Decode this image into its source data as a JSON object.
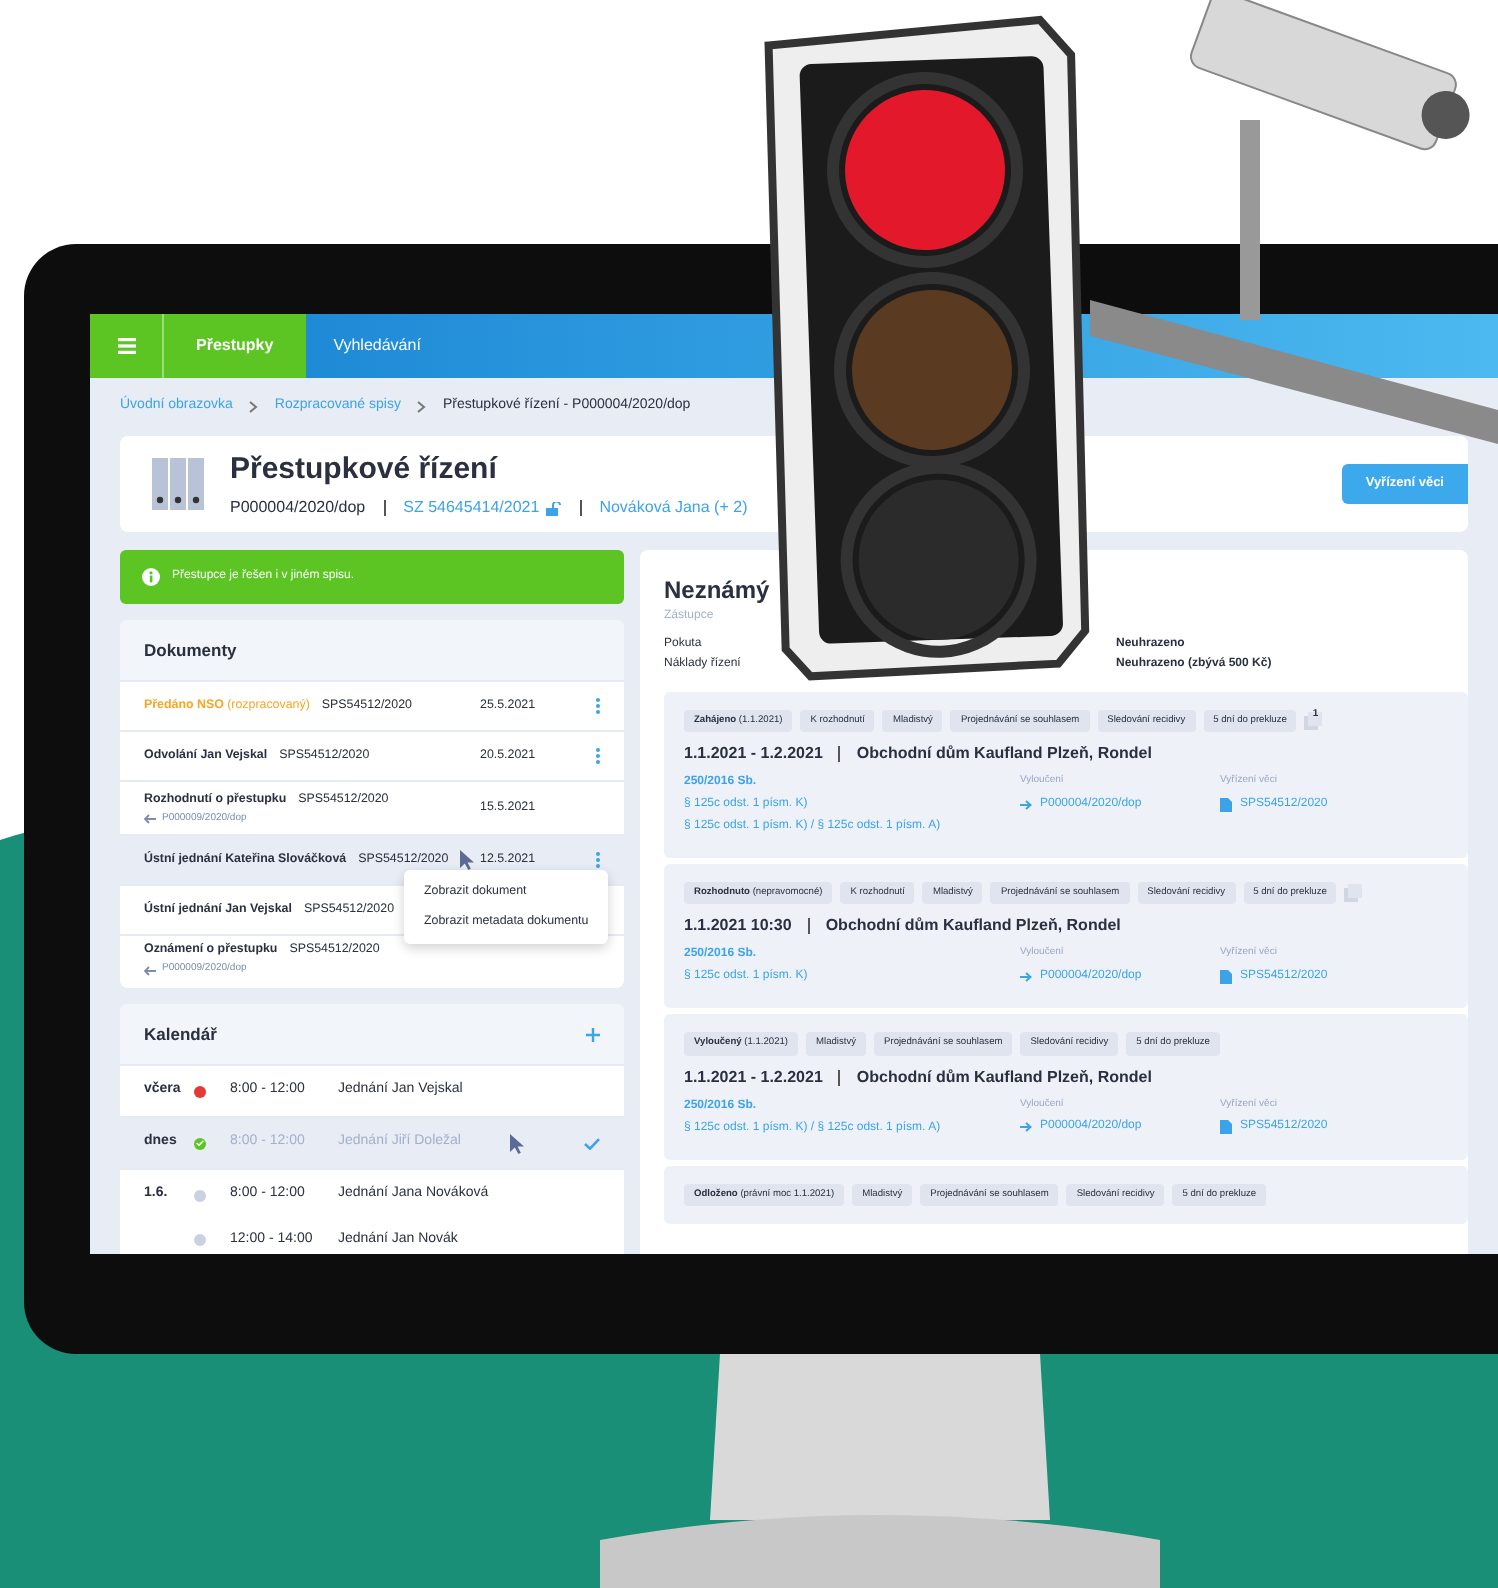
{
  "navbar": {
    "tabs": [
      {
        "label": "Přestupky",
        "selected": true
      },
      {
        "label": "Vyhledávání",
        "selected": false
      }
    ]
  },
  "breadcrumb": [
    "Úvodní obrazovka",
    "Rozpracované spisy",
    "Přestupkové řízení - P000004/2020/dop"
  ],
  "header": {
    "title": "Přestupkové řízení",
    "number": "P000004/2020/dop",
    "link": "SZ 54645414/2021",
    "persons": "Nováková Jana (+ 2)",
    "button": "Vyřízení věci"
  },
  "alert": {
    "text": "Přestupce je řešen i v jiném spisu."
  },
  "documents": {
    "title": "Dokumenty",
    "rows": [
      {
        "kind": "draft",
        "name": "Předáno NSO",
        "status": "(rozpracovaný)",
        "code": "SPS54512/2020",
        "date": "25.5.2021",
        "actions": true,
        "selected": false
      },
      {
        "kind": "normal",
        "name": "Odvolání Jan Vejskal",
        "code": "SPS54512/2020",
        "date": "20.5.2021",
        "actions": true,
        "selected": false
      },
      {
        "kind": "normal",
        "name": "Rozhodnutí o přestupku",
        "code": "SPS54512/2020",
        "date": "15.5.2021",
        "ref": "P000009/2020/dop",
        "actions": false,
        "selected": false
      },
      {
        "kind": "normal",
        "name": "Ústní jednání Kateřina Slováčková",
        "code": "SPS54512/2020",
        "date": "12.5.2021",
        "actions": true,
        "selected": true
      },
      {
        "kind": "normal",
        "name": "Ústní jednání Jan Vejskal",
        "code": "SPS54512/2020",
        "actions": false,
        "selected": false
      },
      {
        "kind": "normal",
        "name": "Oznámení o přestupku",
        "code": "SPS54512/2020",
        "ref": "P000009/2020/dop",
        "actions": false,
        "selected": false
      }
    ],
    "menu": [
      "Zobrazit dokument",
      "Zobrazit metadata dokumentu"
    ]
  },
  "calendar": {
    "title": "Kalendář",
    "events": [
      {
        "day": "včera",
        "color": "#e53935",
        "time": "8:00 - 12:00",
        "title": "Jednání Jan Vejskal",
        "done": false,
        "selected": false
      },
      {
        "day": "dnes",
        "color": "#5cc524",
        "time": "8:00 - 12:00",
        "title": "Jednání Jiří Doležal",
        "done": true,
        "selected": true
      },
      {
        "day": "1.6.",
        "color": "#c9d2e3",
        "time": "8:00 - 12:00",
        "title": "Jednání Jana Nováková",
        "done": false,
        "selected": false
      },
      {
        "color": "#c9d2e3",
        "time": "12:00 - 14:00",
        "title": "Jednání Jan Novák",
        "done": false,
        "selected": false
      }
    ]
  },
  "party": {
    "name": "Neznámý",
    "role": "Zástupce",
    "payments": [
      {
        "label": "Pokuta",
        "value": "Neuhrazeno"
      },
      {
        "label": "Náklady řízení",
        "value": "Neuhrazeno (zbývá 500 Kč)"
      }
    ]
  },
  "cases": [
    {
      "status": {
        "label": "Zahájeno",
        "note": "(1.1.2021)"
      },
      "tags": [
        "K rozhodnutí",
        "Mladistvý",
        "Projednávání se souhlasem",
        "Sledování recidivy",
        "5 dní do prekluze"
      ],
      "copy_icon": true,
      "copy_count": "1",
      "date": "1.1.2021 - 1.2.2021",
      "place": "Obchodní dům Kaufland Plzeň, Rondel",
      "law": "250/2016 Sb.",
      "paragraphs": [
        "§ 125c odst. 1 písm. K)",
        "§ 125c odst. 1 písm. K) / § 125c odst. 1 písm. A)"
      ],
      "exclusion_label": "Vyloučení",
      "exclusion": "P000004/2020/dop",
      "resolution_label": "Vyřízení věci",
      "resolution": "SPS54512/2020"
    },
    {
      "status": {
        "label": "Rozhodnuto",
        "note": "(nepravomocné)"
      },
      "tags": [
        "K rozhodnutí",
        "Mladistvý",
        "Projednávání se souhlasem",
        "Sledování recidivy",
        "5 dní do prekluze"
      ],
      "copy_icon": true,
      "date": "1.1.2021 10:30",
      "place": "Obchodní dům Kaufland Plzeň, Rondel",
      "law": "250/2016 Sb.",
      "paragraphs": [
        "§ 125c odst. 1 písm. K)"
      ],
      "exclusion_label": "Vyloučení",
      "exclusion": "P000004/2020/dop",
      "resolution_label": "Vyřízení věci",
      "resolution": "SPS54512/2020"
    },
    {
      "status": {
        "label": "Vyloučený",
        "note": "(1.1.2021)"
      },
      "tags": [
        "Mladistvý",
        "Projednávání se souhlasem",
        "Sledování recidivy",
        "5 dní do prekluze"
      ],
      "copy_icon": false,
      "date": "1.1.2021 - 1.2.2021",
      "place": "Obchodní dům Kaufland Plzeň, Rondel",
      "law": "250/2016 Sb.",
      "paragraphs": [
        "§ 125c odst. 1 písm. K) / § 125c odst. 1 písm. A)"
      ],
      "exclusion_label": "Vyloučení",
      "exclusion": "P000004/2020/dop",
      "resolution_label": "Vyřízení věci",
      "resolution": "SPS54512/2020"
    },
    {
      "status": {
        "label": "Odloženo",
        "note": "(právní moc 1.1.2021)"
      },
      "tags": [
        "Mladistvý",
        "Projednávání se souhlasem",
        "Sledování recidivy",
        "5 dní do prekluze"
      ],
      "copy_icon": false
    }
  ]
}
